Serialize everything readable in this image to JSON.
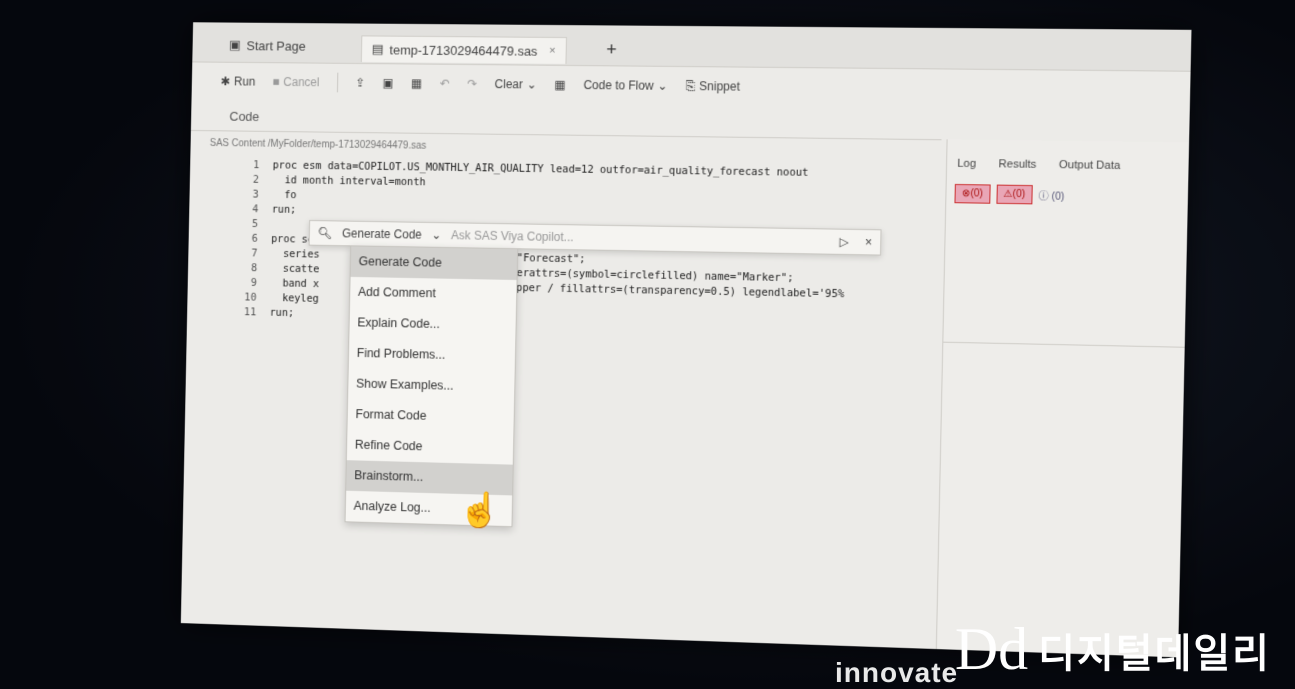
{
  "tabs": {
    "start_label": "Start Page",
    "file_label": "temp-1713029464479.sas",
    "close_glyph": "×",
    "new_tab": "+"
  },
  "toolbar": {
    "run_label": "Run",
    "cancel_label": "Cancel",
    "clear_label": "Clear",
    "code_to_flow_label": "Code to Flow",
    "snippet_label": "Snippet"
  },
  "subbar": {
    "code_tab": "Code"
  },
  "editor": {
    "path": "SAS Content /MyFolder/temp-1713029464479.sas",
    "lines": [
      {
        "n": "1",
        "text": "proc esm data=COPILOT.US_MONTHLY_AIR_QUALITY lead=12 outfor=air_quality_forecast noout"
      },
      {
        "n": "2",
        "text": "  id month interval=month"
      },
      {
        "n": "3",
        "text": "  fo"
      },
      {
        "n": "4",
        "text": "run;"
      },
      {
        "n": "5",
        "text": ""
      },
      {
        "n": "6",
        "text": "proc sgp                          forecast;"
      },
      {
        "n": "7",
        "text": "  series                           name=\"Forecast\";"
      },
      {
        "n": "8",
        "text": "  scatte                            markerattrs=(symbol=circlefilled) name=\"Marker\";"
      },
      {
        "n": "9",
        "text": "  band x                           per=upper / fillattrs=(transparency=0.5) legendlabel='95%"
      },
      {
        "n": "10",
        "text": "  keyleg"
      },
      {
        "n": "11",
        "text": "run;"
      }
    ]
  },
  "copilot": {
    "mode_label": "Generate Code",
    "ask_placeholder": "Ask SAS Viya Copilot...",
    "send_glyph": "▷",
    "close_glyph": "×"
  },
  "menu": {
    "items": [
      "Generate Code",
      "Add Comment",
      "Explain Code...",
      "Find Problems...",
      "Show Examples...",
      "Format Code",
      "Refine Code",
      "Brainstorm...",
      "Analyze Log..."
    ]
  },
  "right_pane": {
    "tabs": [
      "Log",
      "Results",
      "Output Data"
    ],
    "errors_label": "⊗(0)",
    "warnings_label": "⚠(0)",
    "notes_label": "ⓘ (0)"
  },
  "watermark": {
    "logo": "Dd",
    "text": "디지털데일리",
    "innovate": "innovate"
  },
  "colors": {
    "error_badge_bg": "#e9a6b6",
    "error_badge_border": "#cc3333"
  }
}
